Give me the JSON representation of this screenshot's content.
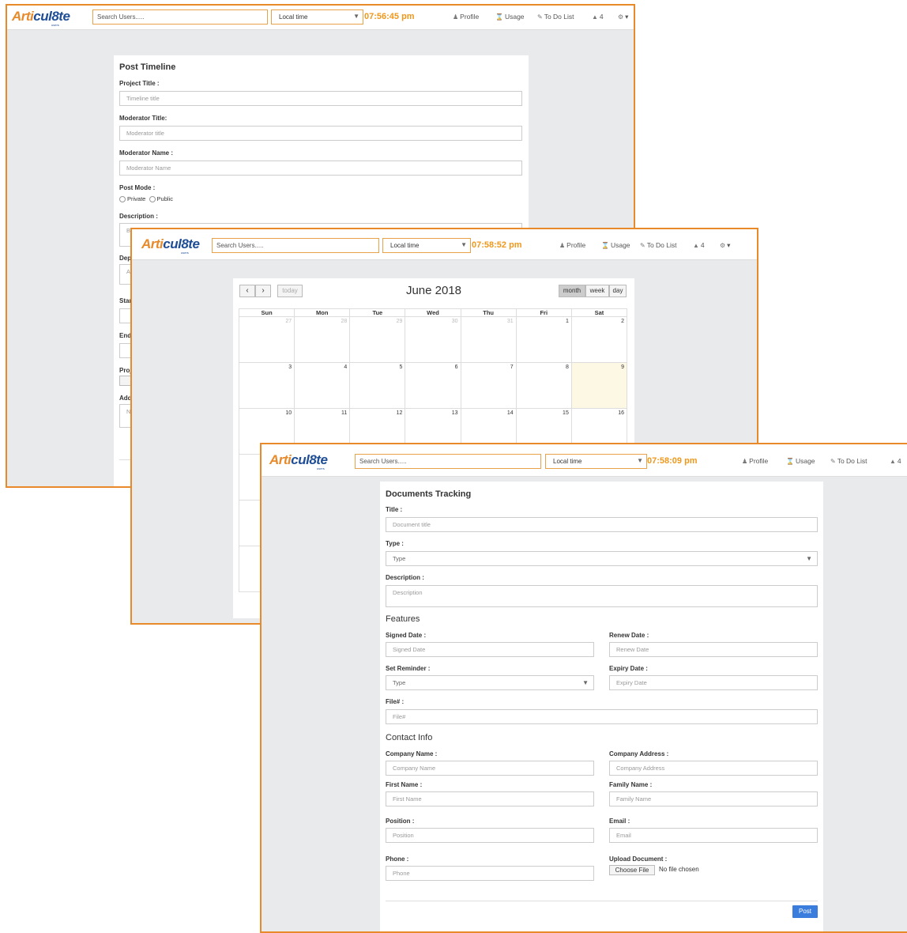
{
  "app": {
    "logo": {
      "part1": "Arti",
      "part2": "cul8te",
      "sub": "users"
    }
  },
  "nav": {
    "search_placeholder": "Search Users.....",
    "tz_label": "Local time",
    "profile": "Profile",
    "usage": "Usage",
    "todo": "To Do List",
    "notifications": "4"
  },
  "win1": {
    "clock": "07:56:45 pm",
    "title": "Post Timeline",
    "project_title_label": "Project Title :",
    "project_title_ph": "Timeline title",
    "moderator_title_label": "Moderator Title:",
    "moderator_title_ph": "Moderator title",
    "moderator_name_label": "Moderator Name :",
    "moderator_name_ph": "Moderator Name",
    "post_mode_label": "Post Mode :",
    "private": "Private",
    "public": "Public",
    "description_label": "Description :",
    "desc_peek": "Br",
    "dep_label": "Dep",
    "dep_peek": "Ac",
    "star_label": "Star",
    "end_label": "End",
    "proj_label": "Proj",
    "choose_peek": "Ch",
    "add_label": "Add",
    "note_peek": "No"
  },
  "win2": {
    "clock": "07:58:52 pm",
    "month_title": "June 2018",
    "today": "today",
    "views": [
      "month",
      "week",
      "day"
    ],
    "days": [
      "Sun",
      "Mon",
      "Tue",
      "Wed",
      "Thu",
      "Fri",
      "Sat"
    ],
    "weeks": [
      [
        "27",
        "28",
        "29",
        "30",
        "31",
        "1",
        "2"
      ],
      [
        "3",
        "4",
        "5",
        "6",
        "7",
        "8",
        "9"
      ],
      [
        "10",
        "11",
        "12",
        "13",
        "14",
        "15",
        "16"
      ]
    ]
  },
  "win3": {
    "clock": "07:58:09 pm",
    "title": "Documents Tracking",
    "title_label": "Title :",
    "title_ph": "Document title",
    "type_label": "Type :",
    "type_value": "Type",
    "description_label": "Description :",
    "description_ph": "Description",
    "features_heading": "Features",
    "signed_date_label": "Signed Date :",
    "signed_date_ph": "Signed Date",
    "renew_date_label": "Renew Date :",
    "renew_date_ph": "Renew Date",
    "set_reminder_label": "Set Reminder :",
    "set_reminder_value": "Type",
    "expiry_date_label": "Expiry Date :",
    "expiry_date_ph": "Expiry Date",
    "file_label": "File# :",
    "file_ph": "File#",
    "contact_heading": "Contact Info",
    "company_name_label": "Company Name :",
    "company_name_ph": "Company Name",
    "company_address_label": "Company Address :",
    "company_address_ph": "Company Address",
    "first_name_label": "First Name :",
    "first_name_ph": "First Name",
    "family_name_label": "Family Name :",
    "family_name_ph": "Family Name",
    "position_label": "Position :",
    "position_ph": "Position",
    "email_label": "Email :",
    "email_ph": "Email",
    "phone_label": "Phone :",
    "phone_ph": "Phone",
    "upload_label": "Upload Document :",
    "choose_file": "Choose File",
    "no_file": "No file chosen",
    "post_button": "Post"
  },
  "colors": {
    "accent": "#e8892a",
    "clock": "#f0981c",
    "brand_blue": "#1f4e96",
    "post_button": "#3b7ddd",
    "today_cell": "#fcf8e3"
  }
}
